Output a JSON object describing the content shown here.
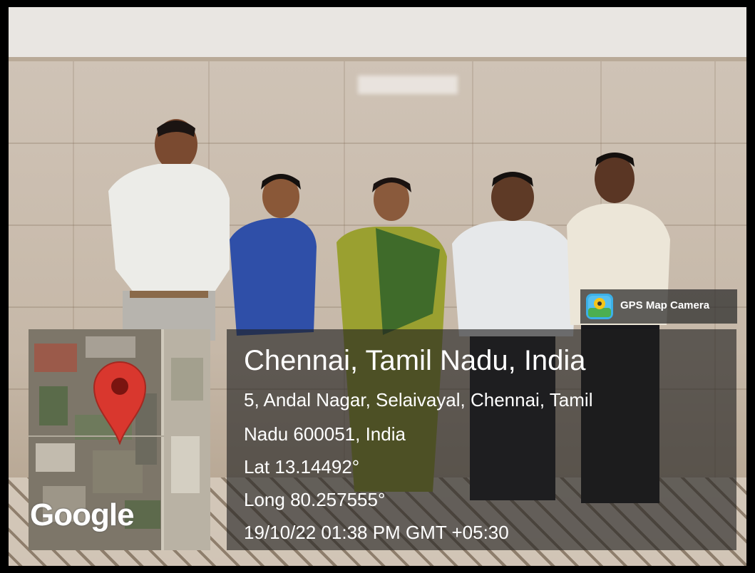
{
  "overlay": {
    "badge_label": "GPS Map Camera",
    "location_title": "Chennai, Tamil Nadu, India",
    "address_line1": "5, Andal Nagar, Selaivayal, Chennai, Tamil",
    "address_line2": "Nadu 600051, India",
    "latitude": "Lat 13.14492°",
    "longitude": "Long 80.257555°",
    "datetime": "19/10/22 01:38 PM GMT +05:30",
    "map_logo": "Google"
  },
  "icons": {
    "badge": "gps-map-camera-icon",
    "map_pin": "map-pin-icon"
  },
  "colors": {
    "pin": "#d9372e",
    "panel": "#1e1e1e",
    "text": "#ffffff"
  }
}
